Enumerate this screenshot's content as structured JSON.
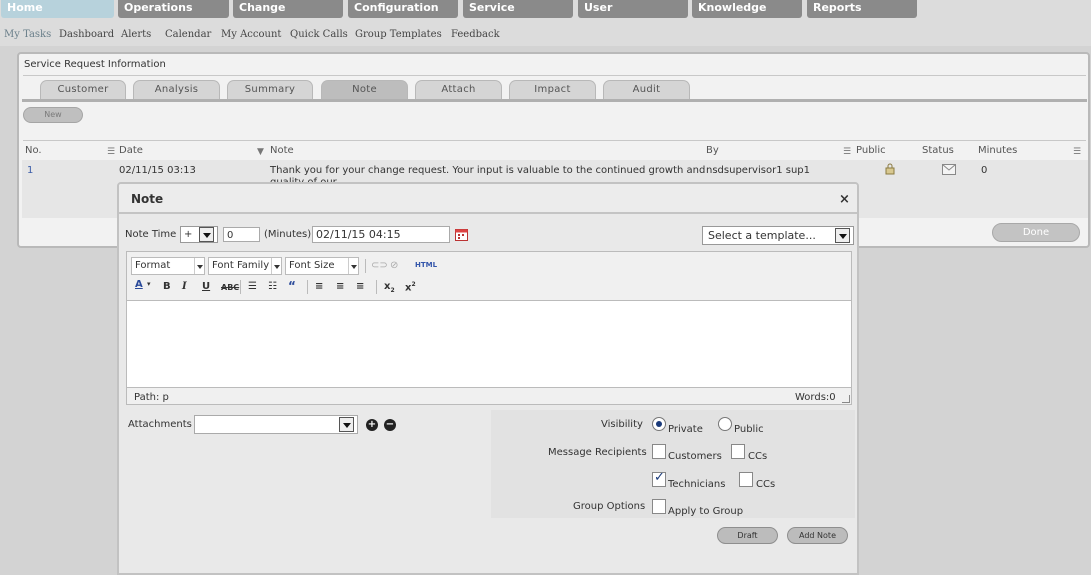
{
  "topnav": {
    "tabs": [
      "Home",
      "Operations",
      "Change",
      "Configuration",
      "Service",
      "User",
      "Knowledge",
      "Reports"
    ],
    "active": "Home"
  },
  "subnav": {
    "links": [
      "My Tasks",
      "Dashboard",
      "Alerts",
      "Calendar",
      "My Account",
      "Quick Calls",
      "Group Templates",
      "Feedback"
    ]
  },
  "service_request": {
    "title": "Service Request Information",
    "tabs": [
      "Customer",
      "Analysis",
      "Summary",
      "Note",
      "Attach",
      "Impact",
      "Audit"
    ],
    "active_tab": "Note",
    "new_label": "New",
    "columns": [
      "No.",
      "Date",
      "Note",
      "By",
      "Public",
      "Status",
      "Minutes"
    ],
    "rows": [
      {
        "no": "1",
        "date": "02/11/15 03:13",
        "note": "Thank you for your change request. Your input is valuable to the continued growth and",
        "note_overflow": "quality of our",
        "by": "nsdsupervisor1 sup1",
        "minutes": "0"
      }
    ],
    "done_label": "Done"
  },
  "note_dialog": {
    "title": "Note",
    "close_glyph": "×",
    "note_time_label": "Note Time",
    "sign_value": "+",
    "minutes_value": "0",
    "minutes_label": "(Minutes)",
    "datetime_value": "02/11/15 04:15",
    "template_placeholder": "Select a template...",
    "toolbar": {
      "format": "Format",
      "font_family": "Font Family",
      "font_size": "Font Size",
      "html_label": "HTML"
    },
    "path_label": "Path: p",
    "words_label": "Words:0",
    "attachments_label": "Attachments",
    "visibility_label": "Visibility",
    "private_label": "Private",
    "public_label": "Public",
    "recipients_label": "Message Recipients",
    "customers_label": "Customers",
    "ccs_label": "CCs",
    "technicians_label": "Technicians",
    "ccs2_label": "CCs",
    "group_options_label": "Group Options",
    "apply_group_label": "Apply to Group",
    "draft_label": "Draft",
    "add_note_label": "Add Note"
  },
  "colors": {
    "active_nav": "#b7d2dc",
    "nav_tab": "#8a8a8a",
    "link_blue": "#3a5ca8",
    "check_blue": "#1a3a7a"
  }
}
